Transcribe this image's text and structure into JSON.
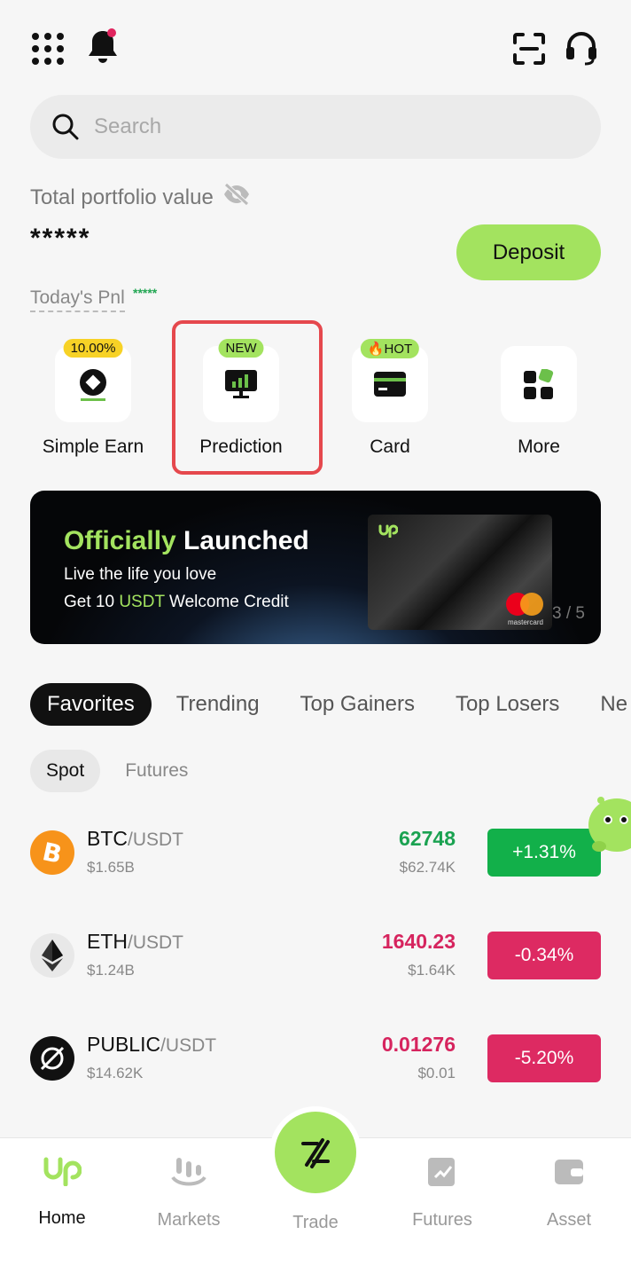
{
  "topbar": {
    "menu_icon": "grid-menu-icon",
    "bell_icon": "bell-icon",
    "scan_icon": "scan-icon",
    "support_icon": "headset-icon"
  },
  "search": {
    "placeholder": "Search"
  },
  "portfolio": {
    "label": "Total portfolio value",
    "masked_value": "*****",
    "deposit_label": "Deposit",
    "pnl_label": "Today's Pnl",
    "pnl_value": "*****"
  },
  "quick_actions": [
    {
      "label": "Simple Earn",
      "badge": "10.00%"
    },
    {
      "label": "Prediction",
      "badge": "NEW"
    },
    {
      "label": "Card",
      "badge": "🔥HOT"
    },
    {
      "label": "More",
      "badge": ""
    }
  ],
  "banner": {
    "title_accent": "Officially",
    "title_rest": " Launched",
    "line1": "Live the life you love",
    "line2_pre": "Get 10 ",
    "line2_accent": "USDT",
    "line2_post": " Welcome Credit",
    "card_brand": "mastercard",
    "pager": "3 / 5"
  },
  "tabs": [
    "Favorites",
    "Trending",
    "Top Gainers",
    "Top Losers",
    "Ne"
  ],
  "subtabs": [
    "Spot",
    "Futures"
  ],
  "markets": [
    {
      "base": "BTC",
      "quote": "/USDT",
      "volume": "$1.65B",
      "price": "62748",
      "fiat": "$62.74K",
      "change": "+1.31%",
      "direction": "up"
    },
    {
      "base": "ETH",
      "quote": "/USDT",
      "volume": "$1.24B",
      "price": "1640.23",
      "fiat": "$1.64K",
      "change": "-0.34%",
      "direction": "down"
    },
    {
      "base": "PUBLIC",
      "quote": "/USDT",
      "volume": "$14.62K",
      "price": "0.01276",
      "fiat": "$0.01",
      "change": "-5.20%",
      "direction": "down"
    }
  ],
  "bottom_nav": [
    {
      "label": "Home",
      "active": true
    },
    {
      "label": "Markets",
      "active": false
    },
    {
      "label": "Trade",
      "active": false
    },
    {
      "label": "Futures",
      "active": false
    },
    {
      "label": "Asset",
      "active": false
    }
  ],
  "colors": {
    "accent": "#a3e35f",
    "up": "#12b04a",
    "down": "#dd2a62",
    "highlight": "#e5484d"
  }
}
